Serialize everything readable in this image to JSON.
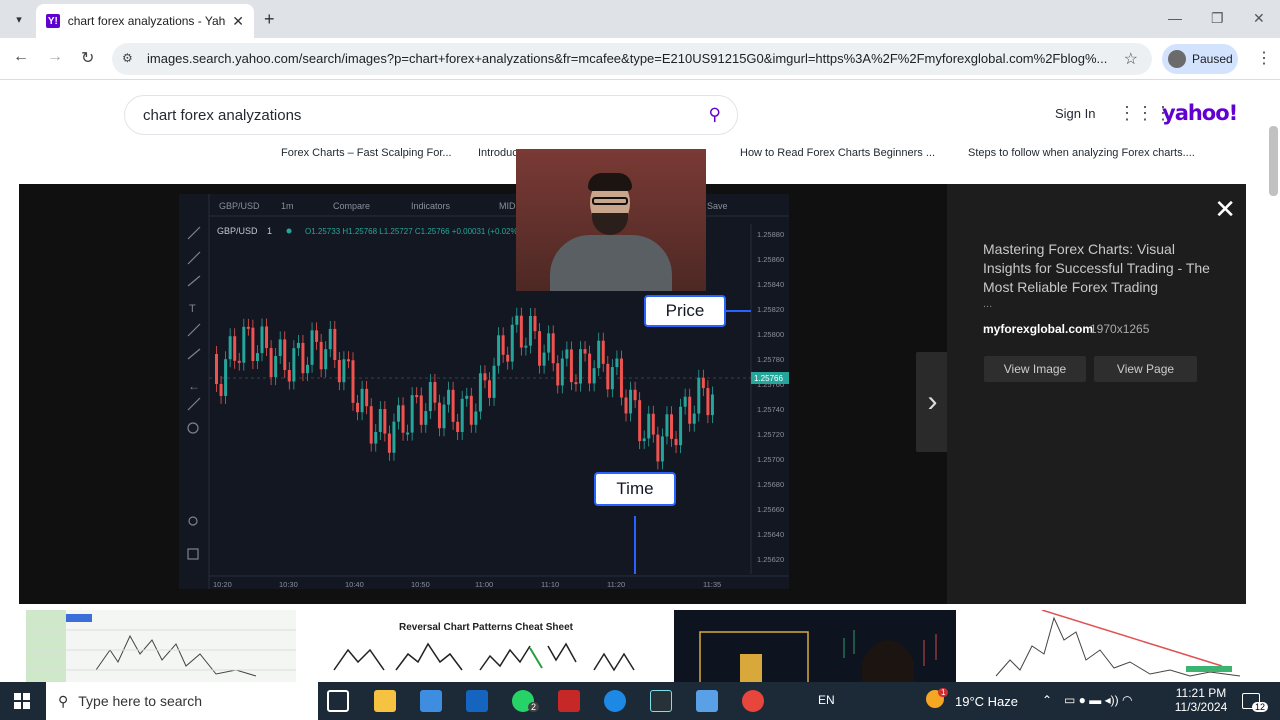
{
  "browser": {
    "tab_title": "chart forex analyzations - Yahoo",
    "tab_favicon": "Y!",
    "url": "images.search.yahoo.com/search/images?p=chart+forex+analyzations&fr=mcafee&type=E210US91215G0&imgurl=https%3A%2F%2Fmyforexglobal.com%2Fblog%...",
    "profile_status": "Paused"
  },
  "header": {
    "search_query": "chart forex analyzations",
    "sign_in": "Sign In",
    "logo": "yahoo!"
  },
  "captions": [
    "Forex Charts – Fast Scalping For...",
    "Introduc",
    "How to Read Forex Charts Beginners ...",
    "Steps to follow when analyzing Forex charts...."
  ],
  "chart": {
    "symbol": "GBP/USD",
    "interval": "1m",
    "compare": "Compare",
    "indicators": "Indicators",
    "mid": "MID",
    "save": "Save",
    "legend_symbol": "GBP/USD",
    "legend_interval": "1",
    "ohlc": "O1.25733 H1.25768 L1.25727 C1.25766 +0.00031 (+0.02%)",
    "price_labels": [
      "1.25880",
      "1.25860",
      "1.25840",
      "1.25820",
      "1.25800",
      "1.25780",
      "1.25760",
      "1.25740",
      "1.25720",
      "1.25700",
      "1.25680",
      "1.25660",
      "1.25640",
      "1.25620"
    ],
    "current_price": "1.25766",
    "time_labels": [
      "10:20",
      "10:30",
      "10:40",
      "10:50",
      "11:00",
      "11:10",
      "11:20",
      "11:35"
    ],
    "callout_price": "Price",
    "callout_time": "Time",
    "colors": {
      "up": "#26a69a",
      "down": "#ef5350",
      "bg": "#131722"
    }
  },
  "detail": {
    "title": "Mastering Forex Charts: Visual Insights for Successful Trading - The Most Reliable Forex Trading",
    "ellipsis": "...",
    "source": "myforexglobal.com",
    "dimensions": "1970x1265",
    "view_image": "View Image",
    "view_page": "View Page"
  },
  "thumbs": {
    "reversal_title": "Reversal Chart Patterns Cheat Sheet"
  },
  "taskbar": {
    "search_placeholder": "Type here to search",
    "whatsapp_badge": "2",
    "lang": "EN",
    "weather": "19°C  Haze",
    "weather_badge": "1",
    "time": "11:21 PM",
    "date": "11/3/2024",
    "notif_count": "12"
  }
}
